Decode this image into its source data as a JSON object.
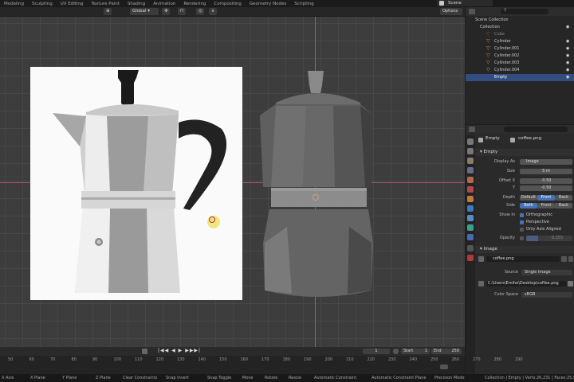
{
  "workspace_tabs": [
    "Modeling",
    "Sculpting",
    "UV Editing",
    "Texture Paint",
    "Shading",
    "Animation",
    "Rendering",
    "Compositing",
    "Geometry Nodes",
    "Scripting"
  ],
  "scene_name": "Scene",
  "viewport": {
    "transform_orientation": "Global",
    "options_label": "Options"
  },
  "outliner": {
    "rows": [
      {
        "label": "Scene Collection",
        "dim": false,
        "sel": false
      },
      {
        "label": "Collection",
        "dim": false,
        "sel": false
      },
      {
        "label": "Cube",
        "dim": true,
        "sel": false
      },
      {
        "label": "Cylinder",
        "dim": false,
        "sel": false
      },
      {
        "label": "Cylinder.001",
        "dim": false,
        "sel": false
      },
      {
        "label": "Cylinder.002",
        "dim": false,
        "sel": false
      },
      {
        "label": "Cylinder.003",
        "dim": false,
        "sel": false
      },
      {
        "label": "Cylinder.004",
        "dim": false,
        "sel": false
      },
      {
        "label": "Empty",
        "dim": false,
        "sel": true
      }
    ]
  },
  "properties": {
    "object_name": "Empty",
    "image_name": "coffee.png",
    "empty_section": "Empty",
    "display_as_label": "Display As",
    "display_as_value": "Image",
    "size_label": "Size",
    "size_value": "5 m",
    "offset_x_label": "Offset X",
    "offset_x_value": "-0.50",
    "offset_y_label": "Y",
    "offset_y_value": "-0.50",
    "depth_label": "Depth",
    "depth_options": [
      "Default",
      "Front",
      "Back"
    ],
    "depth_selected": "Front",
    "side_label": "Side",
    "side_options": [
      "Both",
      "Front",
      "Back"
    ],
    "side_selected": "Both",
    "show_in_label": "Show In",
    "show_in_options": [
      {
        "label": "Orthographic",
        "checked": true
      },
      {
        "label": "Perspective",
        "checked": true
      },
      {
        "label": "Only Axis Aligned",
        "checked": false
      }
    ],
    "opacity_label": "Opacity",
    "opacity_value": "0.255",
    "image_section": "Image",
    "image_datablock": "coffee.png",
    "source_label": "Source",
    "source_value": "Single Image",
    "filepath": "C:\\Users\\Emihe\\Desktop\\coffee.png",
    "color_space_label": "Color Space",
    "color_space_value": "sRGB"
  },
  "timeline": {
    "current_frame": "1",
    "start_label": "Start",
    "start_value": "1",
    "end_label": "End",
    "end_value": "250",
    "ticks": [
      "50",
      "60",
      "70",
      "80",
      "90",
      "100",
      "110",
      "120",
      "130",
      "140",
      "150",
      "160",
      "170",
      "180",
      "190",
      "200",
      "210",
      "220",
      "230",
      "240",
      "250",
      "260",
      "270",
      "280",
      "290"
    ]
  },
  "statusbar": {
    "items": [
      "X Axis",
      "X Plane",
      "Y Plane",
      "Z Plane",
      "Clear Constraints",
      "Snap Invert",
      "Snap Toggle",
      "Move",
      "Rotate",
      "Resize",
      "Automatic Constraint",
      "Automatic Constraint Plane",
      "Precision Mode"
    ],
    "stats": "Collection | Empty | Verts:26,231 | Faces:25,953"
  }
}
